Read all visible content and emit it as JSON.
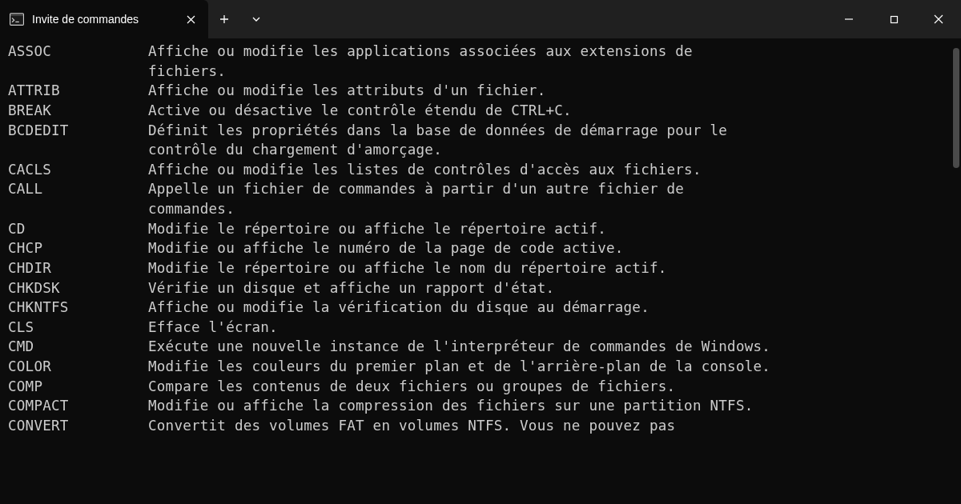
{
  "titlebar": {
    "tab_title": "Invite de commandes",
    "close_symbol": "✕",
    "new_tab_symbol": "+",
    "dropdown_symbol": "⌄",
    "minimize_symbol": "—",
    "maximize_symbol": "☐",
    "window_close_symbol": "✕"
  },
  "commands": [
    {
      "name": "ASSOC",
      "desc": "Affiche ou modifie les applications associées aux extensions de fichiers."
    },
    {
      "name": "ATTRIB",
      "desc": "Affiche ou modifie les attributs d'un fichier."
    },
    {
      "name": "BREAK",
      "desc": "Active ou désactive le contrôle étendu de CTRL+C."
    },
    {
      "name": "BCDEDIT",
      "desc": "Définit les propriétés dans la base de données de démarrage pour le contrôle du chargement d'amorçage."
    },
    {
      "name": "CACLS",
      "desc": "Affiche ou modifie les listes de contrôles d'accès aux fichiers."
    },
    {
      "name": "CALL",
      "desc": "Appelle un fichier de commandes à partir d'un autre fichier de commandes."
    },
    {
      "name": "CD",
      "desc": "Modifie le répertoire ou affiche le répertoire actif."
    },
    {
      "name": "CHCP",
      "desc": "Modifie ou affiche le numéro de la page de code active."
    },
    {
      "name": "CHDIR",
      "desc": "Modifie le répertoire ou affiche le nom du répertoire actif."
    },
    {
      "name": "CHKDSK",
      "desc": "Vérifie un disque et affiche un rapport d'état."
    },
    {
      "name": "CHKNTFS",
      "desc": "Affiche ou modifie la vérification du disque au démarrage."
    },
    {
      "name": "CLS",
      "desc": "Efface l'écran."
    },
    {
      "name": "CMD",
      "desc": "Exécute une nouvelle instance de l'interpréteur de commandes de Windows."
    },
    {
      "name": "COLOR",
      "desc": "Modifie les couleurs du premier plan et de l'arrière-plan de la console."
    },
    {
      "name": "COMP",
      "desc": "Compare les contenus de deux fichiers ou groupes de fichiers."
    },
    {
      "name": "COMPACT",
      "desc": "Modifie ou affiche la compression des fichiers sur une partition NTFS."
    },
    {
      "name": "CONVERT",
      "desc": "Convertit des volumes FAT en volumes NTFS. Vous ne pouvez pas"
    }
  ]
}
